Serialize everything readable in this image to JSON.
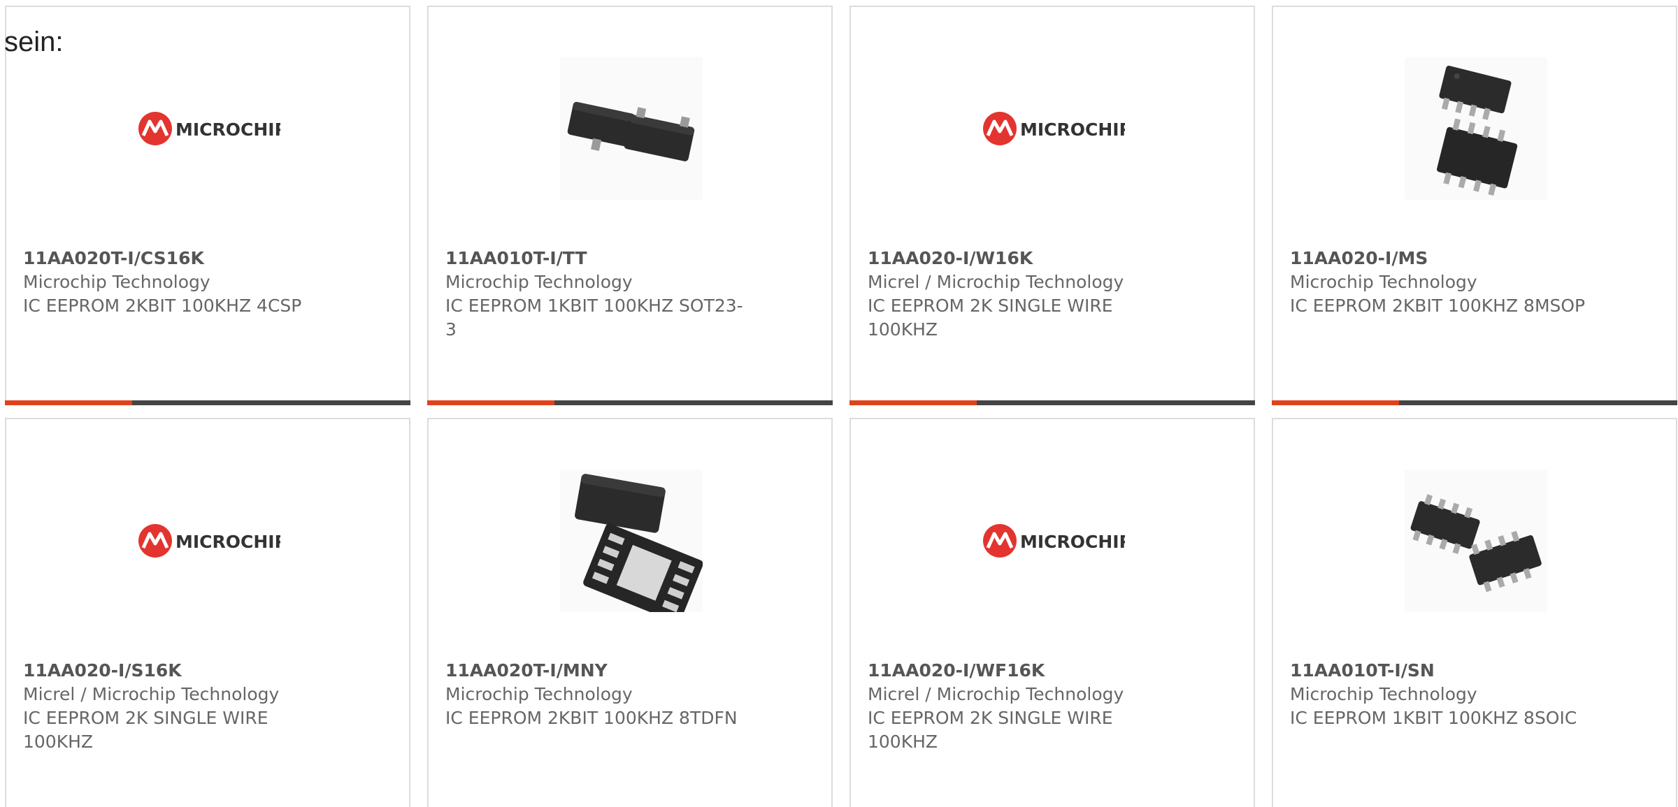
{
  "intro_text": "sein:",
  "colors": {
    "accent": "#e0421b",
    "bar": "#444444",
    "border": "#dcdcdc",
    "logo_red": "#e3342f"
  },
  "logo_text": "MICROCHIP",
  "products": [
    {
      "part_number": "11AA020T-I/CS16K",
      "manufacturer": "Microchip Technology",
      "description": "IC EEPROM 2KBIT 100KHZ 4CSP",
      "image": "microchip-logo"
    },
    {
      "part_number": "11AA010T-I/TT",
      "manufacturer": "Microchip Technology",
      "description": "IC EEPROM 1KBIT 100KHZ SOT23-3",
      "image": "sot23-package"
    },
    {
      "part_number": "11AA020-I/W16K",
      "manufacturer": "Micrel / Microchip Technology",
      "description": "IC EEPROM 2K SINGLE WIRE 100KHZ",
      "image": "microchip-logo"
    },
    {
      "part_number": "11AA020-I/MS",
      "manufacturer": "Microchip Technology",
      "description": "IC EEPROM 2KBIT 100KHZ 8MSOP",
      "image": "msop-package"
    },
    {
      "part_number": "11AA020-I/S16K",
      "manufacturer": "Micrel / Microchip Technology",
      "description": "IC EEPROM 2K SINGLE WIRE 100KHZ",
      "image": "microchip-logo"
    },
    {
      "part_number": "11AA020T-I/MNY",
      "manufacturer": "Microchip Technology",
      "description": "IC EEPROM 2KBIT 100KHZ 8TDFN",
      "image": "tdfn-package"
    },
    {
      "part_number": "11AA020-I/WF16K",
      "manufacturer": "Micrel / Microchip Technology",
      "description": "IC EEPROM 2K SINGLE WIRE 100KHZ",
      "image": "microchip-logo"
    },
    {
      "part_number": "11AA010T-I/SN",
      "manufacturer": "Microchip Technology",
      "description": "IC EEPROM 1KBIT 100KHZ 8SOIC",
      "image": "soic-package"
    }
  ]
}
